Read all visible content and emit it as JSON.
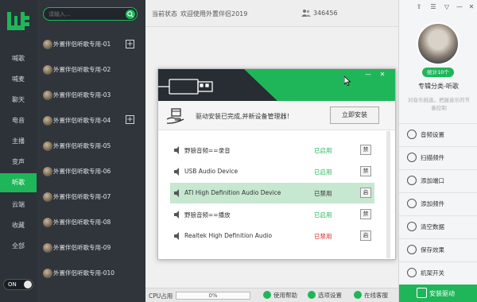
{
  "nav": {
    "items": [
      {
        "label": "喊歌"
      },
      {
        "label": "喊麦"
      },
      {
        "label": "聊天"
      },
      {
        "label": "电音"
      },
      {
        "label": "主播"
      },
      {
        "label": "变声"
      },
      {
        "label": "听歌"
      },
      {
        "label": "云端"
      },
      {
        "label": "收藏"
      },
      {
        "label": "全部"
      }
    ],
    "active_index": 6,
    "toggle_label": "ON"
  },
  "search": {
    "placeholder": "请输入..."
  },
  "channels": [
    {
      "label": "外置伴侣听歌专用-01"
    },
    {
      "label": "外置伴侣听歌专用-02"
    },
    {
      "label": "外置伴侣听歌专用-03"
    },
    {
      "label": "外置伴侣听歌专用-04"
    },
    {
      "label": "外置伴侣听歌专用-05"
    },
    {
      "label": "外置伴侣听歌专用-06"
    },
    {
      "label": "外置伴侣听歌专用-07"
    },
    {
      "label": "外置伴侣听歌专用-08"
    },
    {
      "label": "外置伴侣听歌专用-09"
    },
    {
      "label": "外置伴侣听歌专用-010"
    }
  ],
  "header": {
    "status_label": "当前状态",
    "status_text": "欢迎使用外置伴侣2019",
    "online_count": "346456"
  },
  "dialog": {
    "message": "驱动安装已完成,并新设备管理器！",
    "install_button": "立即安装",
    "devices": [
      {
        "name": "野狼音频==录音",
        "status": "已启用",
        "status_color": "#1fb65a",
        "action": "禁"
      },
      {
        "name": "USB Audio Device",
        "status": "已启用",
        "status_color": "#1fb65a",
        "action": "禁"
      },
      {
        "name": "ATI High Definition Audio Device",
        "status": "已禁用",
        "status_color": "#333333",
        "action": "启"
      },
      {
        "name": "野狼音频==播放",
        "status": "已启用",
        "status_color": "#1fb65a",
        "action": "禁"
      },
      {
        "name": "Realtek High Definition Audio",
        "status": "已禁用",
        "status_color": "#d12b2b",
        "action": "启"
      }
    ],
    "selected_index": 2
  },
  "bottom": {
    "cpu_label": "CPU占用",
    "cpu_value": "0%",
    "cpu_fraction": 0,
    "help": "使用帮助",
    "settings": "选项设置",
    "support": "在线客服"
  },
  "right": {
    "stat_label": "统计10个",
    "title": "专辑分类-听歌",
    "subtitle": "对音乐挑选，把握音乐的节奏控制",
    "menu": [
      {
        "label": "音频设置"
      },
      {
        "label": "扫描频件"
      },
      {
        "label": "添加端口"
      },
      {
        "label": "添加频件"
      },
      {
        "label": "清空数据"
      },
      {
        "label": "保存效果"
      },
      {
        "label": "机架开关"
      }
    ],
    "bottom_label": "安装驱动"
  },
  "colors": {
    "accent": "#1fb65a",
    "nav_bg": "#2c3238",
    "list_bg": "#2f353b",
    "disabled_red": "#d12b2b"
  }
}
